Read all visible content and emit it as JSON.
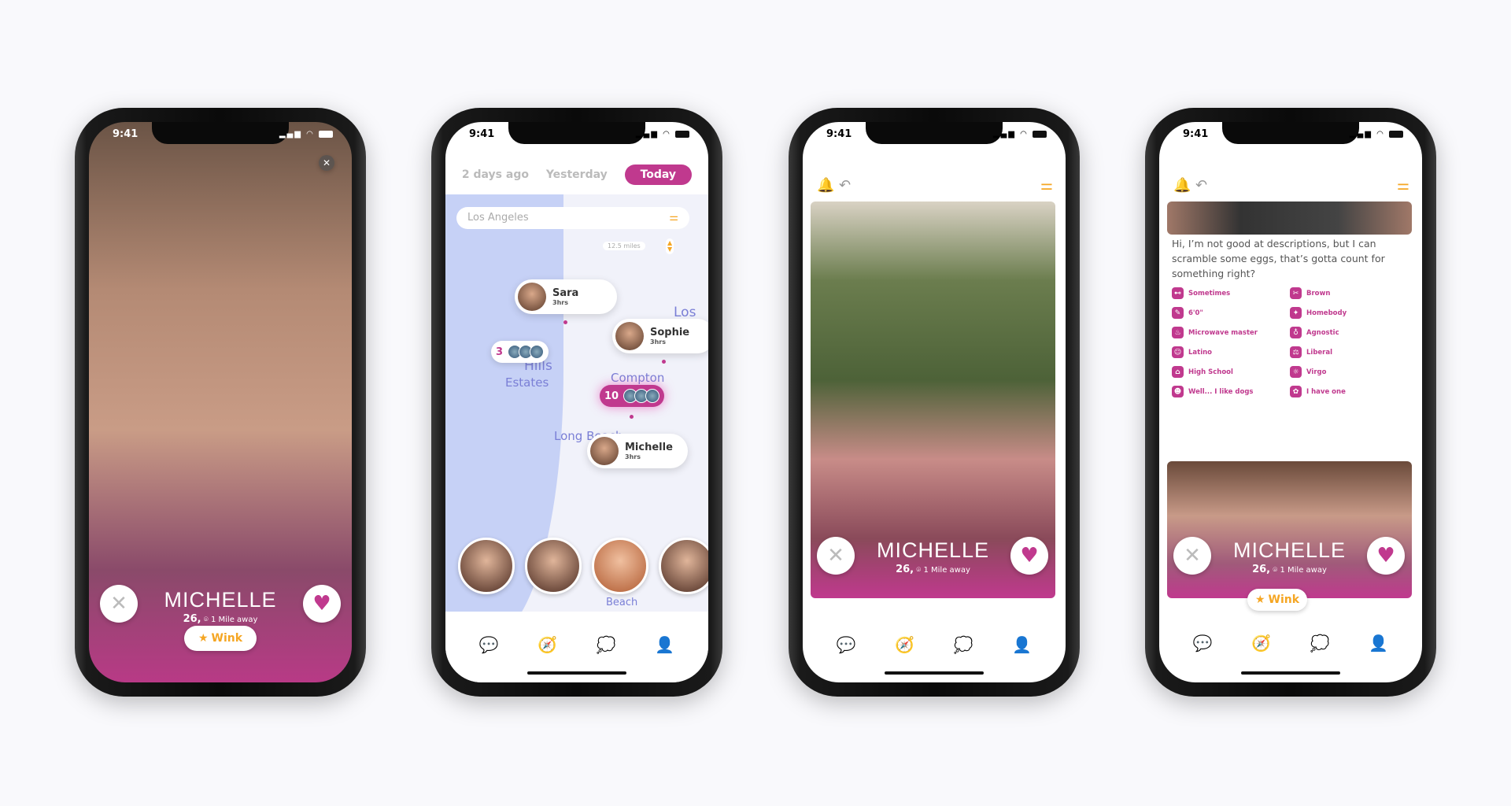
{
  "status": {
    "time": "9:41"
  },
  "colors": {
    "accent": "#c0398e",
    "star": "#f5a623",
    "water": "#c6d1f6"
  },
  "profile": {
    "name": "MICHELLE",
    "age": "26,",
    "distance": "1 Mile away",
    "wink_label": "Wink"
  },
  "discover": {
    "tabs": [
      "2 days ago",
      "Yesterday",
      "Today"
    ],
    "active_tab": "Today",
    "search_value": "Los Angeles",
    "radius": "12.5 miles",
    "pins": [
      {
        "name": "Sara",
        "time": "3hrs"
      },
      {
        "name": "Sophie",
        "time": "3hrs"
      },
      {
        "name": "Michelle",
        "time": "3hrs"
      }
    ],
    "clusters": [
      {
        "count": "3"
      },
      {
        "count": "10"
      }
    ],
    "cities": [
      "Los",
      "Hills",
      "Estates",
      "Compton",
      "Long Beach",
      "Beach"
    ]
  },
  "bio": "Hi, I’m not good at descriptions, but I can scramble some eggs, that’s gotta count for something right?",
  "traits": [
    {
      "icon": "dumbbell-icon",
      "label": "Sometimes"
    },
    {
      "icon": "hair-icon",
      "label": "Brown"
    },
    {
      "icon": "ruler-icon",
      "label": "6'0\""
    },
    {
      "icon": "party-icon",
      "label": "Homebody"
    },
    {
      "icon": "chef-icon",
      "label": "Microwave master"
    },
    {
      "icon": "religion-icon",
      "label": "Agnostic"
    },
    {
      "icon": "people-icon",
      "label": "Latino"
    },
    {
      "icon": "politics-icon",
      "label": "Liberal"
    },
    {
      "icon": "graduation-icon",
      "label": "High School"
    },
    {
      "icon": "zodiac-icon",
      "label": "Virgo"
    },
    {
      "icon": "pet-icon",
      "label": "Well... I like dogs"
    },
    {
      "icon": "paw-icon",
      "label": "I have one"
    }
  ],
  "nav": [
    "matches",
    "discover",
    "messages",
    "profile"
  ]
}
